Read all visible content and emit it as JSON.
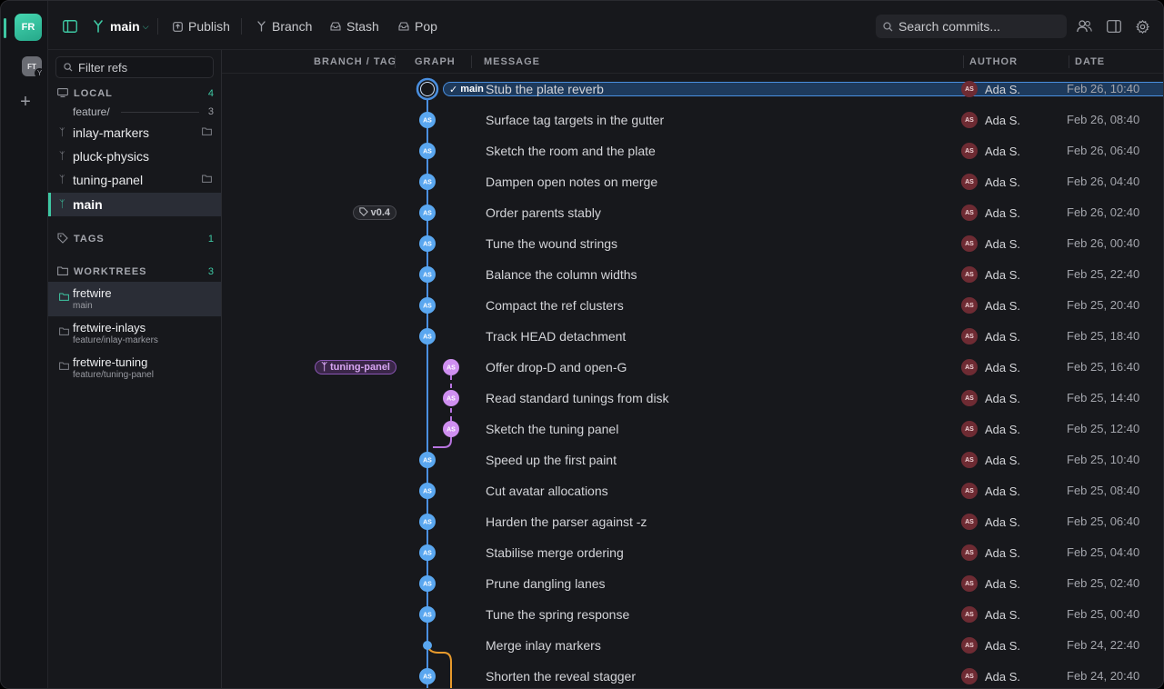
{
  "workspaces": [
    {
      "initials": "FR",
      "active": true
    },
    {
      "initials": "FT",
      "active": false,
      "badge": "Y"
    }
  ],
  "rail_add": "+",
  "toolbar": {
    "branch": "main",
    "publish": "Publish",
    "branch_btn": "Branch",
    "stash": "Stash",
    "pop": "Pop",
    "search_placeholder": "Search commits..."
  },
  "sidebar": {
    "filter_placeholder": "Filter refs",
    "local": {
      "title": "LOCAL",
      "count": "4",
      "folder": {
        "name": "feature/",
        "count": "3"
      },
      "branches": [
        {
          "name": "inlay-markers",
          "worktree": true
        },
        {
          "name": "pluck-physics",
          "worktree": false
        },
        {
          "name": "tuning-panel",
          "worktree": true
        },
        {
          "name": "main",
          "worktree": false,
          "selected": true
        }
      ]
    },
    "tags": {
      "title": "TAGS",
      "count": "1"
    },
    "worktrees": {
      "title": "WORKTREES",
      "count": "3",
      "items": [
        {
          "name": "fretwire",
          "branch": "main",
          "selected": true
        },
        {
          "name": "fretwire-inlays",
          "branch": "feature/inlay-markers"
        },
        {
          "name": "fretwire-tuning",
          "branch": "feature/tuning-panel"
        }
      ]
    }
  },
  "columns": {
    "ref": "BRANCH / TAG",
    "graph": "GRAPH",
    "message": "MESSAGE",
    "author": "AUTHOR",
    "date": "DATE"
  },
  "avatar_initials": "AS",
  "commits": [
    {
      "message": "Stub the plate reverb",
      "author": "Ada S.",
      "date": "Feb 26, 10:40",
      "ref": {
        "kind": "branch-head",
        "label": "main"
      },
      "lane": 0,
      "head": true
    },
    {
      "message": "Surface tag targets in the gutter",
      "author": "Ada S.",
      "date": "Feb 26, 08:40",
      "lane": 0
    },
    {
      "message": "Sketch the room and the plate",
      "author": "Ada S.",
      "date": "Feb 26, 06:40",
      "lane": 0
    },
    {
      "message": "Dampen open notes on merge",
      "author": "Ada S.",
      "date": "Feb 26, 04:40",
      "lane": 0
    },
    {
      "message": "Order parents stably",
      "author": "Ada S.",
      "date": "Feb 26, 02:40",
      "ref": {
        "kind": "tag",
        "label": "v0.4"
      },
      "lane": 0
    },
    {
      "message": "Tune the wound strings",
      "author": "Ada S.",
      "date": "Feb 26, 00:40",
      "lane": 0
    },
    {
      "message": "Balance the column widths",
      "author": "Ada S.",
      "date": "Feb 25, 22:40",
      "lane": 0
    },
    {
      "message": "Compact the ref clusters",
      "author": "Ada S.",
      "date": "Feb 25, 20:40",
      "lane": 0
    },
    {
      "message": "Track HEAD detachment",
      "author": "Ada S.",
      "date": "Feb 25, 18:40",
      "lane": 0
    },
    {
      "message": "Offer drop-D and open-G",
      "author": "Ada S.",
      "date": "Feb 25, 16:40",
      "ref": {
        "kind": "branch",
        "label": "tuning-panel"
      },
      "lane": 1
    },
    {
      "message": "Read standard tunings from disk",
      "author": "Ada S.",
      "date": "Feb 25, 14:40",
      "lane": 1
    },
    {
      "message": "Sketch the tuning panel",
      "author": "Ada S.",
      "date": "Feb 25, 12:40",
      "lane": 1
    },
    {
      "message": "Speed up the first paint",
      "author": "Ada S.",
      "date": "Feb 25, 10:40",
      "lane": 0
    },
    {
      "message": "Cut avatar allocations",
      "author": "Ada S.",
      "date": "Feb 25, 08:40",
      "lane": 0
    },
    {
      "message": "Harden the parser against -z",
      "author": "Ada S.",
      "date": "Feb 25, 06:40",
      "lane": 0
    },
    {
      "message": "Stabilise merge ordering",
      "author": "Ada S.",
      "date": "Feb 25, 04:40",
      "lane": 0
    },
    {
      "message": "Prune dangling lanes",
      "author": "Ada S.",
      "date": "Feb 25, 02:40",
      "lane": 0
    },
    {
      "message": "Tune the spring response",
      "author": "Ada S.",
      "date": "Feb 25, 00:40",
      "lane": 0
    },
    {
      "message": "Merge inlay markers",
      "author": "Ada S.",
      "date": "Feb 24, 22:40",
      "lane": 0,
      "merge": true
    },
    {
      "message": "Shorten the reveal stagger",
      "author": "Ada S.",
      "date": "Feb 24, 20:40",
      "lane": 0
    }
  ],
  "colors": {
    "accent": "#3ec8a3",
    "lane_main": "#4a8fe0",
    "lane_main_node": "#5aa7f0",
    "lane_tuning": "#b874e0",
    "lane_tuning_node": "#cf8ff0",
    "lane_inlay": "#e89a2c",
    "author_avatar": "#6e2b33"
  }
}
